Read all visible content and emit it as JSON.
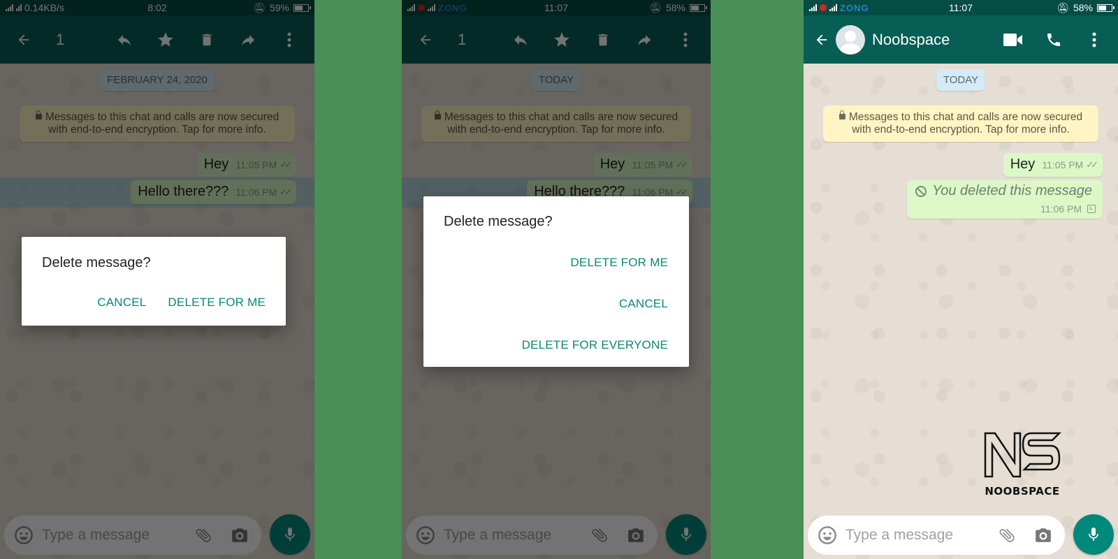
{
  "panels": [
    {
      "status": {
        "network": "0.14KB/s",
        "carrier": "",
        "time": "8:02",
        "battery": "59%",
        "battery_level": 0.59
      },
      "appbar": {
        "mode": "selection",
        "selected_count": "1"
      },
      "chat": {
        "date_chip": "FEBRUARY 24, 2020",
        "e2e_notice": "Messages to this chat and calls are now secured with end-to-end encryption. Tap for more info.",
        "messages": [
          {
            "text": "Hey",
            "time": "11:05 PM",
            "status": "read",
            "selected": false
          },
          {
            "text": "Hello there???",
            "time": "11:06 PM",
            "status": "read",
            "selected": true
          }
        ]
      },
      "dialog": {
        "title": "Delete message?",
        "buttons": [
          "CANCEL",
          "DELETE FOR ME"
        ]
      },
      "composer": {
        "placeholder": "Type a message"
      }
    },
    {
      "status": {
        "network": "",
        "carrier": "ZONG",
        "time": "11:07",
        "battery": "58%",
        "battery_level": 0.58
      },
      "appbar": {
        "mode": "selection",
        "selected_count": "1"
      },
      "chat": {
        "date_chip": "TODAY",
        "e2e_notice": "Messages to this chat and calls are now secured with end-to-end encryption. Tap for more info.",
        "messages": [
          {
            "text": "Hey",
            "time": "11:05 PM",
            "status": "read",
            "selected": false
          },
          {
            "text": "Hello there???",
            "time": "11:06 PM",
            "status": "read",
            "selected": true
          }
        ]
      },
      "dialog": {
        "title": "Delete message?",
        "buttons": [
          "DELETE FOR ME",
          "CANCEL",
          "DELETE FOR EVERYONE"
        ]
      },
      "composer": {
        "placeholder": "Type a message"
      }
    },
    {
      "status": {
        "network": "",
        "carrier": "ZONG",
        "time": "11:07",
        "battery": "58%",
        "battery_level": 0.58
      },
      "appbar": {
        "mode": "conversation",
        "contact_name": "Noobspace"
      },
      "chat": {
        "date_chip": "TODAY",
        "e2e_notice": "Messages to this chat and calls are now secured with end-to-end encryption. Tap for more info.",
        "messages": [
          {
            "text": "Hey",
            "time": "11:05 PM",
            "status": "read"
          },
          {
            "text": "You deleted this message",
            "time": "11:06 PM",
            "status": "pending",
            "deleted": true
          }
        ]
      },
      "composer": {
        "placeholder": "Type a message"
      },
      "watermark": {
        "logo": "NS",
        "text": "NOOBSPACE"
      }
    }
  ],
  "colors": {
    "header": "#075e54",
    "statusbar": "#054d44",
    "accent": "#00897b",
    "dialog_button": "#07887a",
    "outgoing_bubble": "#dcf8c6",
    "e2e_notice": "#fff5c4",
    "date_chip": "#d4eaf4",
    "background": "#4a8f55"
  }
}
